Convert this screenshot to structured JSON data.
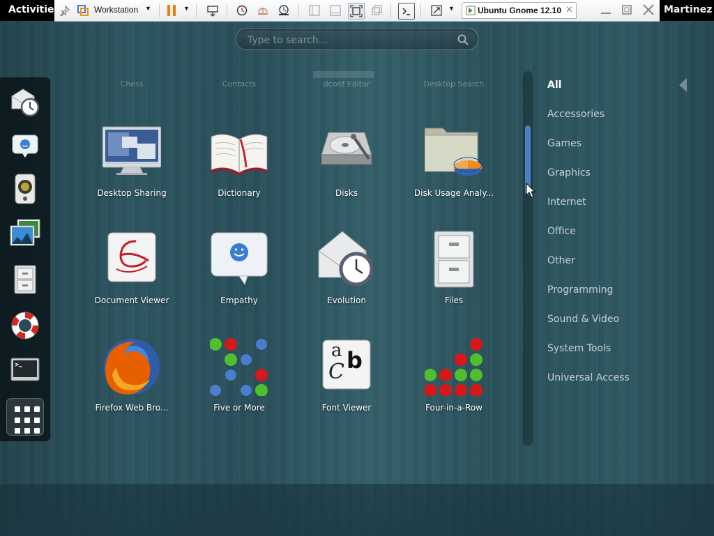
{
  "topbar": {
    "activities_label": "Activities",
    "user_name": "Martinez"
  },
  "vm_toolbar": {
    "vm_library_label": "Workstation",
    "tab_title": "Ubuntu Gnome 12.10"
  },
  "search": {
    "placeholder": "Type to search..."
  },
  "dash": {
    "items": [
      {
        "icon": "evolution-mail-clock-icon"
      },
      {
        "icon": "empathy-chat-icon"
      },
      {
        "icon": "rhythmbox-speaker-icon"
      },
      {
        "icon": "shotwell-photos-icon"
      },
      {
        "icon": "files-cabinet-icon"
      },
      {
        "icon": "help-lifebuoy-icon"
      },
      {
        "icon": "terminal-icon"
      }
    ],
    "show_apps_icon": "grid-icon"
  },
  "app_grid": {
    "faded_row": [
      "Chess",
      "Contacts",
      "dconf Editor",
      "Desktop Search"
    ],
    "apps": [
      {
        "label": "Desktop Sharing",
        "icon": "desktop-sharing-icon"
      },
      {
        "label": "Dictionary",
        "icon": "dictionary-book-icon"
      },
      {
        "label": "Disks",
        "icon": "disks-drive-icon"
      },
      {
        "label": "Disk Usage Analy...",
        "icon": "disk-usage-analyzer-icon"
      },
      {
        "label": "Document Viewer",
        "icon": "document-viewer-icon"
      },
      {
        "label": "Empathy",
        "icon": "empathy-chat-icon"
      },
      {
        "label": "Evolution",
        "icon": "evolution-mail-clock-icon"
      },
      {
        "label": "Files",
        "icon": "files-cabinet-icon"
      },
      {
        "label": "Firefox Web Bro...",
        "icon": "firefox-icon"
      },
      {
        "label": "Five or More",
        "icon": "five-or-more-icon"
      },
      {
        "label": "Font Viewer",
        "icon": "font-viewer-icon"
      },
      {
        "label": "Four-in-a-Row",
        "icon": "four-in-a-row-icon"
      }
    ],
    "font_viewer_glyphs": {
      "a": "a",
      "b": "b",
      "c": "C"
    }
  },
  "categories": [
    {
      "label": "All",
      "selected": true
    },
    {
      "label": "Accessories",
      "selected": false
    },
    {
      "label": "Games",
      "selected": false
    },
    {
      "label": "Graphics",
      "selected": false
    },
    {
      "label": "Internet",
      "selected": false
    },
    {
      "label": "Office",
      "selected": false
    },
    {
      "label": "Other",
      "selected": false
    },
    {
      "label": "Programming",
      "selected": false
    },
    {
      "label": "Sound & Video",
      "selected": false
    },
    {
      "label": "System Tools",
      "selected": false
    },
    {
      "label": "Universal Access",
      "selected": false
    }
  ],
  "colors": {
    "background": "#2d5560",
    "selection_blue": "#4e80c0",
    "firefox_orange": "#e66000"
  }
}
